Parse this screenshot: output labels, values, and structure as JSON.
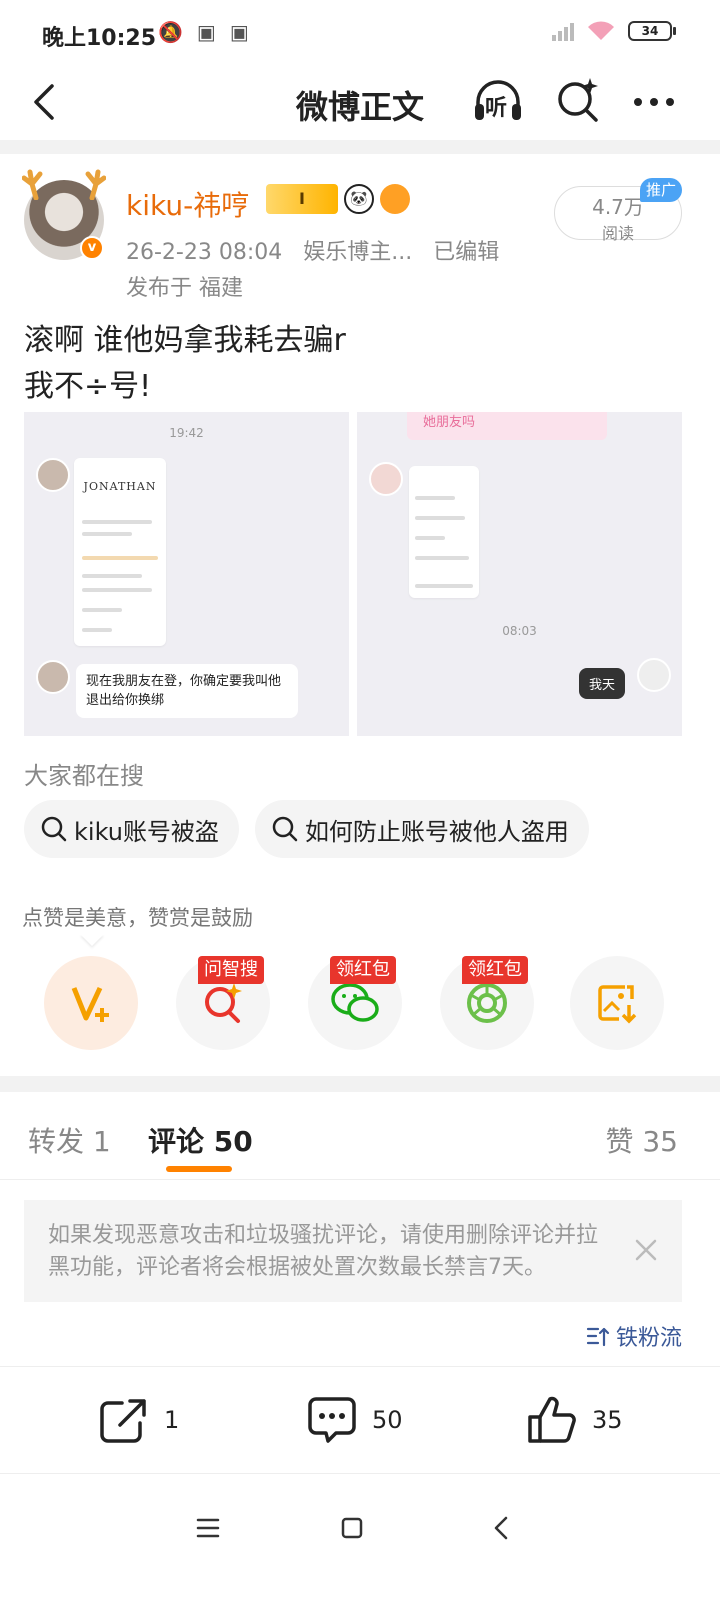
{
  "status_bar": {
    "time": "晚上10:25",
    "battery": "34",
    "left_icons": [
      "mute-bell-icon",
      "app-notification-icon",
      "app-notification-icon"
    ]
  },
  "nav": {
    "title": "微博正文",
    "listen_label": "听"
  },
  "post": {
    "username": "kiku-祎哼",
    "vip_badge": "I",
    "date": "26-2-23 08:04",
    "source": "娱乐博主...",
    "edited": "已编辑",
    "location": "发布于 福建",
    "reads": "4.7万",
    "reads_label": "阅读",
    "promo_tag": "推广",
    "text": "滚啊   谁他妈拿我耗去骗r\n我不÷号!"
  },
  "images": {
    "left": {
      "time": "19:42",
      "brand": "JONATHAN",
      "message": "现在我朋友在登，你确定要我叫他退出给你换绑"
    },
    "right": {
      "banner": "她朋友吗",
      "time": "08:03",
      "message": "我天"
    }
  },
  "search": {
    "title": "大家都在搜",
    "chips": [
      "kiku账号被盗",
      "如何防止账号被他人盗用"
    ]
  },
  "reward": {
    "text": "点赞是美意，赞赏是鼓励",
    "tags": [
      "问智搜",
      "领红包",
      "领红包"
    ]
  },
  "tabs": {
    "repost": "转发 1",
    "comment": "评论 50",
    "like": "赞 35"
  },
  "notice": {
    "text": "如果发现恶意攻击和垃圾骚扰评论，请使用删除评论并拉黑功能，评论者将会根据被处置次数最长禁言7天。"
  },
  "sort": {
    "label": "铁粉流"
  },
  "bottom": {
    "repost_count": "1",
    "comment_count": "50",
    "like_count": "35"
  },
  "colors": {
    "accent": "#ff8200",
    "username": "#e86b0a",
    "promo": "#4ba3f5",
    "tag_red": "#e8352c",
    "link_blue": "#3b5998"
  }
}
